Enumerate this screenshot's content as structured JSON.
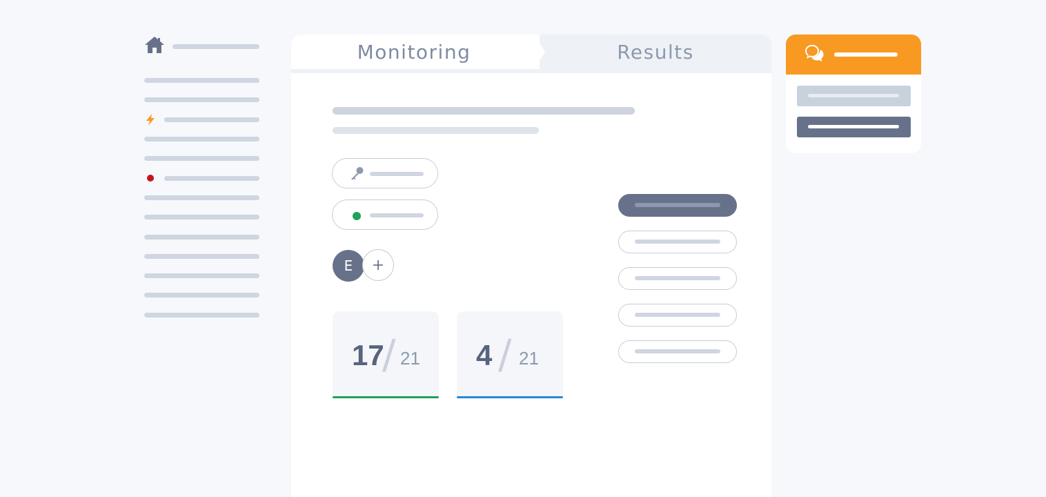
{
  "colors": {
    "accent": "#f89a21",
    "slate": "#67728a",
    "green": "#1fa25a",
    "blue": "#2389d6",
    "red": "#c3161c",
    "placeholder_bar": "#cfd6e1"
  },
  "sidebar": {
    "icons": [
      "home-icon",
      "bolt-icon",
      "red-dot-icon"
    ]
  },
  "tabs": [
    {
      "label": "Monitoring",
      "active": true
    },
    {
      "label": "Results",
      "active": false
    }
  ],
  "avatar": {
    "initial": "E"
  },
  "stats": [
    {
      "value": "17",
      "total": "21",
      "color": "#1fa25a"
    },
    {
      "value": "4",
      "total": "21",
      "color": "#2389d6"
    }
  ],
  "options": {
    "selected_index": 0,
    "count": 5
  },
  "chat": {
    "icon": "chat-bubbles-icon"
  }
}
